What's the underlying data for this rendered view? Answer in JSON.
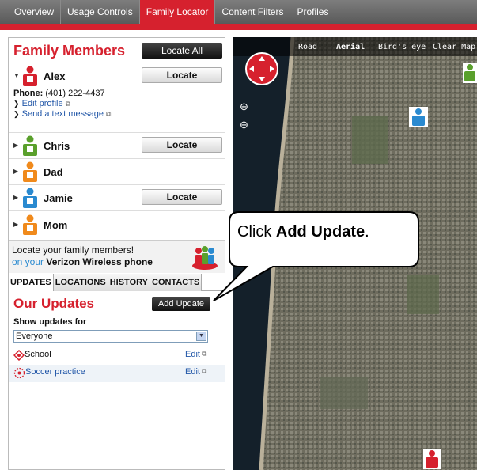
{
  "nav": {
    "tabs": [
      "Overview",
      "Usage Controls",
      "Family Locator",
      "Content Filters",
      "Profiles"
    ],
    "active": 2
  },
  "family": {
    "title": "Family Members",
    "locate_all": "Locate All",
    "members": [
      {
        "name": "Alex",
        "color": "#d6212e",
        "locate": "Locate",
        "expanded": true
      },
      {
        "name": "Chris",
        "color": "#5aa02c",
        "locate": "Locate"
      },
      {
        "name": "Dad",
        "color": "#f08a1c",
        "locate": ""
      },
      {
        "name": "Jamie",
        "color": "#2a8ad0",
        "locate": "Locate"
      },
      {
        "name": "Mom",
        "color": "#f08a1c",
        "locate": ""
      }
    ],
    "alex_phone_label": "Phone:",
    "alex_phone": "(401) 222-4437",
    "edit_profile": "Edit profile",
    "send_text": "Send a text message"
  },
  "promo": {
    "line1": "Locate your family members!",
    "line2a": "on your",
    "line2b": "Verizon Wireless phone"
  },
  "subtabs": [
    "UPDATES",
    "LOCATIONS",
    "HISTORY",
    "CONTACTS"
  ],
  "updates": {
    "title": "Our Updates",
    "add_update": "Add Update",
    "show_for": "Show updates for",
    "select_value": "Everyone",
    "rows": [
      {
        "label": "School",
        "edit": "Edit"
      },
      {
        "label": "Soccer practice",
        "edit": "Edit"
      }
    ]
  },
  "map": {
    "modes": [
      "Road",
      "Aerial",
      "Bird's eye",
      "Clear Map"
    ],
    "active": "Aerial"
  },
  "callout": {
    "prefix": "Click ",
    "bold": "Add Update",
    "suffix": "."
  },
  "colors": {
    "brand_red": "#d6212e"
  }
}
